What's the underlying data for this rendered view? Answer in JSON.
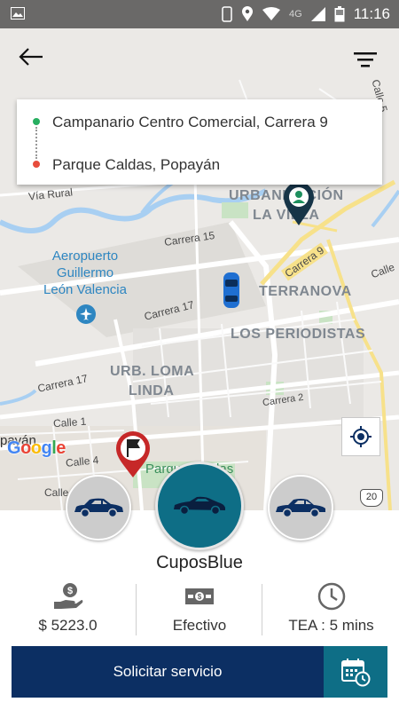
{
  "status_bar": {
    "network": "4G",
    "time": "11:16",
    "icons": [
      "image-icon",
      "phone-icon",
      "location-icon",
      "wifi-icon",
      "signal-icon",
      "battery-icon"
    ]
  },
  "map": {
    "labels": {
      "calle": "Calle 5",
      "via_rural": "Vía Rural",
      "urbanizacion": "URBANIZACIÓN",
      "la_villa": "LA VILLA",
      "carrera15": "Carrera 15",
      "carrera9": "Carrera 9",
      "airport_line1": "Aeropuerto",
      "airport_line2": "Guillermo",
      "airport_line3": "León Valencia",
      "terranova": "TERRANOVA",
      "carrera17a": "Carrera 17",
      "los_periodistas": "LOS PERIODISTAS",
      "carrera17b": "Carrera 17",
      "urb_loma": "URB. LOMA",
      "linda": "LINDA",
      "carrera2": "Carrera 2",
      "calle1": "Calle 1",
      "calle4": "Calle 4",
      "popayan": "payán",
      "calle_bottom": "Calle",
      "parque": "Parque Caldas",
      "route_badge": "20",
      "google": "Google"
    }
  },
  "route": {
    "origin": "Campanario Centro Comercial, Carrera 9",
    "destination": "Parque Caldas, Popayán"
  },
  "service": {
    "name": "CuposBlue",
    "price": "$ 5223.0",
    "payment": "Efectivo",
    "time": "TEA : 5 mins"
  },
  "actions": {
    "request_label": "Solicitar servicio"
  },
  "colors": {
    "primary_dark": "#0c2f63",
    "teal": "#0e6e86",
    "origin_dot": "#27ae60",
    "dest_dot": "#e74c3c"
  }
}
